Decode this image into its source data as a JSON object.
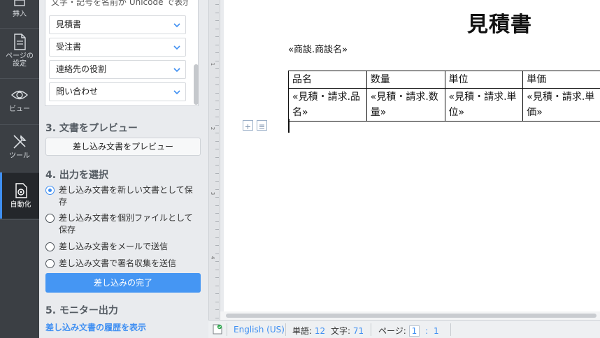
{
  "rail": {
    "items": [
      {
        "label": "挿入",
        "icon": "insert-icon"
      },
      {
        "label": "ページの\n設定",
        "icon": "page-setup-icon"
      },
      {
        "label": "ビュー",
        "icon": "eye-icon"
      },
      {
        "label": "ツール",
        "icon": "tools-icon"
      },
      {
        "label": "自動化",
        "icon": "automation-icon"
      }
    ]
  },
  "panel": {
    "list_top_text": "文字・記号を名前が Unicode で表示",
    "list_items": [
      "見積書",
      "受注書",
      "連絡先の役割",
      "問い合わせ"
    ],
    "section3_title": "3. 文書をプレビュー",
    "preview_button": "差し込み文書をプレビュー",
    "section4_title": "4. 出力を選択",
    "options": [
      {
        "label": "差し込み文書を新しい文書として保存",
        "selected": true
      },
      {
        "label": "差し込み文書を個別ファイルとして保存",
        "selected": false
      },
      {
        "label": "差し込み文書をメールで送信",
        "selected": false
      },
      {
        "label": "差し込み文書で署名収集を送信",
        "selected": false
      }
    ],
    "complete_button": "差し込みの完了",
    "section5_title": "5. モニター出力",
    "history_link": "差し込み文書の履歴を表示"
  },
  "ruler": {
    "numbers": [
      "1",
      "2",
      "3",
      "4"
    ]
  },
  "document": {
    "title": "見積書",
    "merge_field": "«商談.商談名»",
    "table": {
      "headers": [
        "品名",
        "数量",
        "単位",
        "単価"
      ],
      "cells": [
        "«見積・請求.品名»",
        "«見積・請求.数量»",
        "«見積・請求.単位»",
        "«見積・請求.単価»"
      ]
    }
  },
  "status": {
    "language": "English (US)",
    "words_label": "単語:",
    "words": "12",
    "chars_label": "文字:",
    "chars": "71",
    "page_label": "ページ:",
    "page_current": "1",
    "page_sep": ":",
    "page_total": "1"
  },
  "colors": {
    "accent": "#3f8ff2",
    "rail_bg": "#3b3f44",
    "panel_bg": "#e9ebee"
  }
}
